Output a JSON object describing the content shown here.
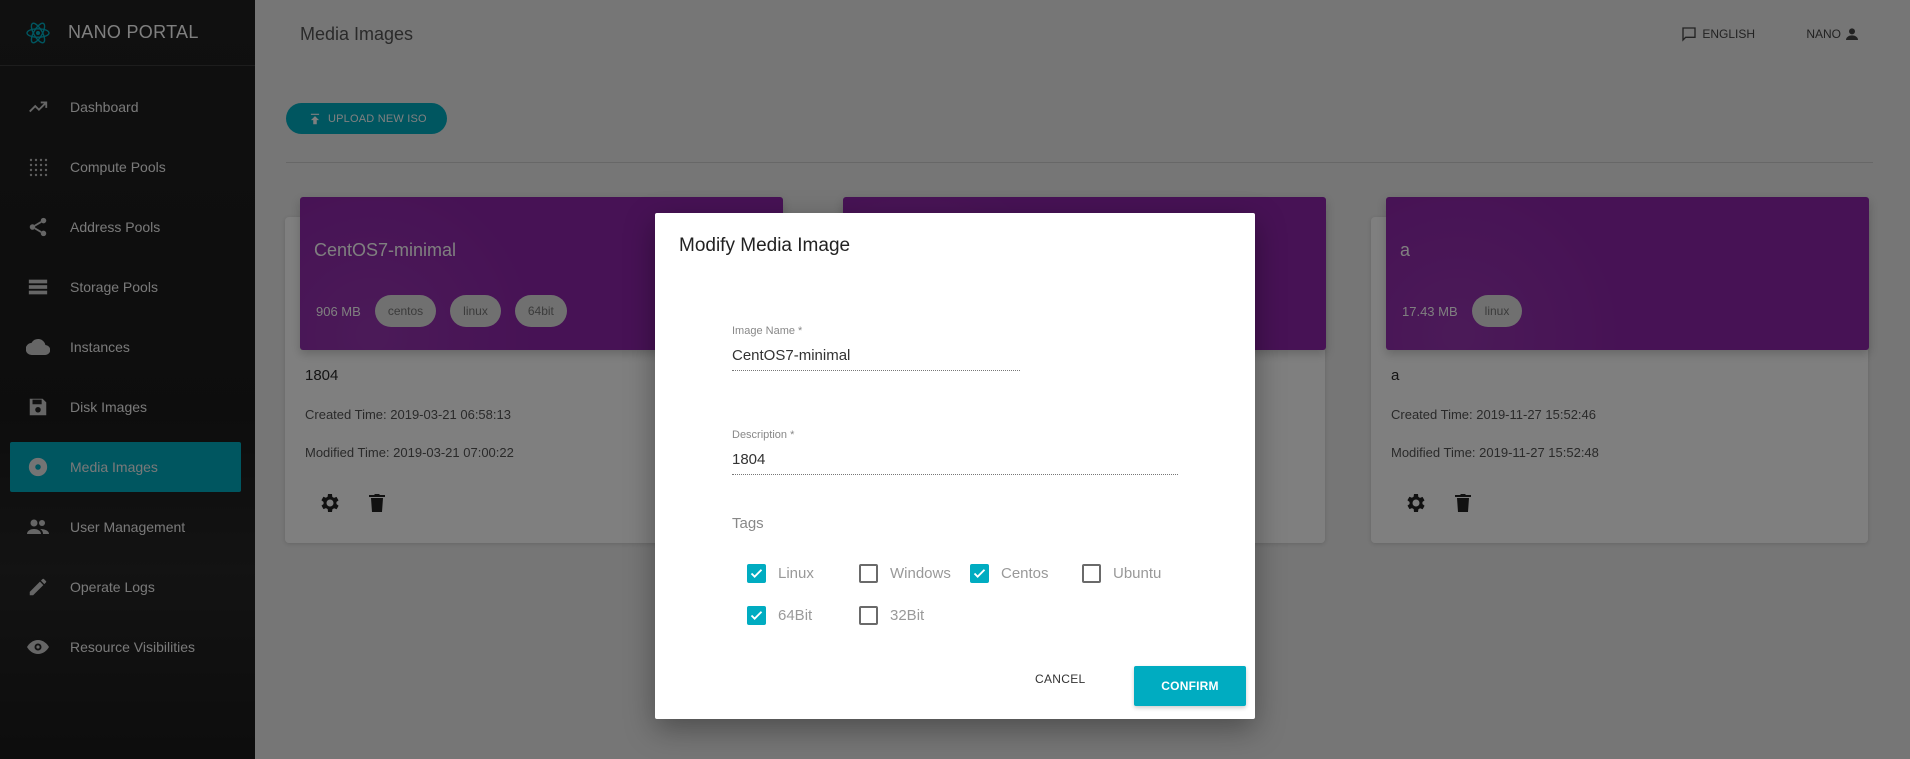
{
  "app": {
    "name": "NANO PORTAL",
    "logo_icon": "atom-icon"
  },
  "sidebar": {
    "items": [
      {
        "label": "Dashboard",
        "icon": "trending-icon",
        "active": false
      },
      {
        "label": "Compute Pools",
        "icon": "grid-dots-icon",
        "active": false
      },
      {
        "label": "Address Pools",
        "icon": "share-icon",
        "active": false
      },
      {
        "label": "Storage Pools",
        "icon": "storage-icon",
        "active": false
      },
      {
        "label": "Instances",
        "icon": "cloud-icon",
        "active": false
      },
      {
        "label": "Disk Images",
        "icon": "save-icon",
        "active": false
      },
      {
        "label": "Media Images",
        "icon": "disc-icon",
        "active": true
      },
      {
        "label": "User Management",
        "icon": "people-icon",
        "active": false
      },
      {
        "label": "Operate Logs",
        "icon": "pencil-icon",
        "active": false
      },
      {
        "label": "Resource Visibilities",
        "icon": "eye-icon",
        "active": false
      }
    ]
  },
  "header": {
    "title": "Media Images",
    "language": "ENGLISH",
    "user": "NANO"
  },
  "toolbar": {
    "upload_label": "UPLOAD NEW ISO"
  },
  "cards": [
    {
      "name": "CentOS7-minimal",
      "size": "906 MB",
      "tags": [
        "centos",
        "linux",
        "64bit"
      ],
      "description": "1804",
      "created": "Created Time: 2019-03-21 06:58:13",
      "modified": "Modified Time: 2019-03-21 07:00:22"
    },
    {
      "name": "",
      "size": "",
      "tags": [],
      "description": "",
      "created": "",
      "modified": ""
    },
    {
      "name": "a",
      "size": "17.43 MB",
      "tags": [
        "linux"
      ],
      "description": "a",
      "created": "Created Time: 2019-11-27 15:52:46",
      "modified": "Modified Time: 2019-11-27 15:52:48"
    }
  ],
  "dialog": {
    "title": "Modify Media Image",
    "name_label": "Image Name *",
    "name_value": "CentOS7-minimal",
    "desc_label": "Description *",
    "desc_value": "1804",
    "tags_label": "Tags",
    "tags": [
      {
        "label": "Linux",
        "checked": true
      },
      {
        "label": "Windows",
        "checked": false
      },
      {
        "label": "Centos",
        "checked": true
      },
      {
        "label": "Ubuntu",
        "checked": false
      },
      {
        "label": "64Bit",
        "checked": true
      },
      {
        "label": "32Bit",
        "checked": false
      }
    ],
    "cancel_label": "CANCEL",
    "confirm_label": "CONFIRM"
  },
  "colors": {
    "accent": "#00acc1",
    "card_header": "#8e24aa",
    "sidebar": "#1e1e1e"
  }
}
